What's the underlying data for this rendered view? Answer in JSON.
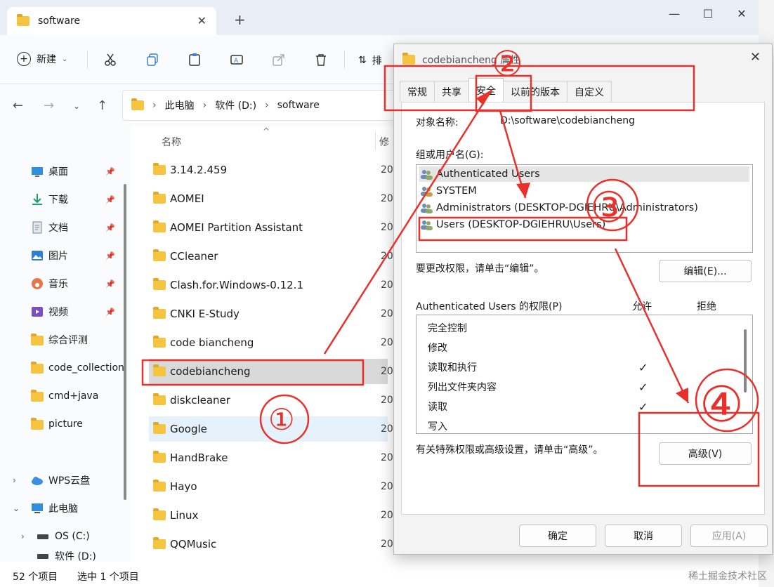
{
  "explorer": {
    "tab_title": "software",
    "new_tab": "+",
    "toolbar": {
      "new_label": "新建",
      "sort_label": "排"
    },
    "address": {
      "root": "此电脑",
      "drive": "软件 (D:)",
      "folder": "software"
    },
    "column_name": "名称",
    "column_modified": "修",
    "sidebar": [
      {
        "label": "桌面",
        "icon": "desktop-icon",
        "pinned": true
      },
      {
        "label": "下载",
        "icon": "download-icon",
        "pinned": true
      },
      {
        "label": "文档",
        "icon": "document-icon",
        "pinned": true
      },
      {
        "label": "图片",
        "icon": "picture-icon",
        "pinned": true
      },
      {
        "label": "音乐",
        "icon": "music-icon",
        "pinned": true
      },
      {
        "label": "视频",
        "icon": "video-icon",
        "pinned": true
      },
      {
        "label": "综合评测",
        "icon": "folder-icon",
        "pinned": false
      },
      {
        "label": "code_collection",
        "icon": "folder-icon",
        "pinned": false
      },
      {
        "label": "cmd+java",
        "icon": "folder-icon",
        "pinned": false
      },
      {
        "label": "picture",
        "icon": "folder-icon",
        "pinned": false
      },
      {
        "label": "WPS云盘",
        "icon": "cloud-icon",
        "pinned": false
      },
      {
        "label": "此电脑",
        "icon": "computer-icon",
        "pinned": false
      },
      {
        "label": "OS (C:)",
        "icon": "drive-icon",
        "pinned": false
      },
      {
        "label": "软件 (D:)",
        "icon": "drive-icon",
        "pinned": false
      }
    ],
    "files": [
      {
        "name": "3.14.2.459",
        "date": "20"
      },
      {
        "name": "AOMEI",
        "date": "20"
      },
      {
        "name": "AOMEI Partition Assistant",
        "date": "20"
      },
      {
        "name": "CCleaner",
        "date": "20"
      },
      {
        "name": "Clash.for.Windows-0.12.1",
        "date": "20"
      },
      {
        "name": "CNKI E-Study",
        "date": "20"
      },
      {
        "name": "code biancheng",
        "date": "20"
      },
      {
        "name": "codebiancheng",
        "date": "20"
      },
      {
        "name": "diskcleaner",
        "date": "20"
      },
      {
        "name": "Google",
        "date": "20"
      },
      {
        "name": "HandBrake",
        "date": "20"
      },
      {
        "name": "Hayo",
        "date": "20"
      },
      {
        "name": "Linux",
        "date": "20"
      },
      {
        "name": "QQMusic",
        "date": "20"
      }
    ],
    "status": {
      "count": "52 个项目",
      "selected": "选中 1 个项目"
    }
  },
  "dialog": {
    "title": "codebiancheng 属性",
    "tabs": [
      "常规",
      "共享",
      "安全",
      "以前的版本",
      "自定义"
    ],
    "active_tab": "安全",
    "object_label": "对象名称:",
    "object_value": "D:\\software\\codebiancheng",
    "group_label": "组或用户名(G):",
    "groups": [
      "Authenticated Users",
      "SYSTEM",
      "Administrators (DESKTOP-DGIEHRU\\Administrators)",
      "Users (DESKTOP-DGIEHRU\\Users)"
    ],
    "edit_note": "要更改权限，请单击“编辑”。",
    "edit_button": "编辑(E)...",
    "perm_label": "Authenticated Users 的权限(P)",
    "allow_label": "允许",
    "deny_label": "拒绝",
    "permissions": [
      {
        "name": "完全控制",
        "allow": ""
      },
      {
        "name": "修改",
        "allow": ""
      },
      {
        "name": "读取和执行",
        "allow": "✓"
      },
      {
        "name": "列出文件夹内容",
        "allow": "✓"
      },
      {
        "name": "读取",
        "allow": "✓"
      },
      {
        "name": "写入",
        "allow": ""
      }
    ],
    "advanced_note": "有关特殊权限或高级设置，请单击“高级”。",
    "advanced_button": "高级(V)",
    "ok_button": "确定",
    "cancel_button": "取消",
    "apply_button": "应用(A)"
  },
  "annotations": {
    "marker_color": "#e8312b",
    "labels": [
      "①",
      "②",
      "③",
      "④"
    ]
  },
  "watermark": "稀土掘金技术社区"
}
